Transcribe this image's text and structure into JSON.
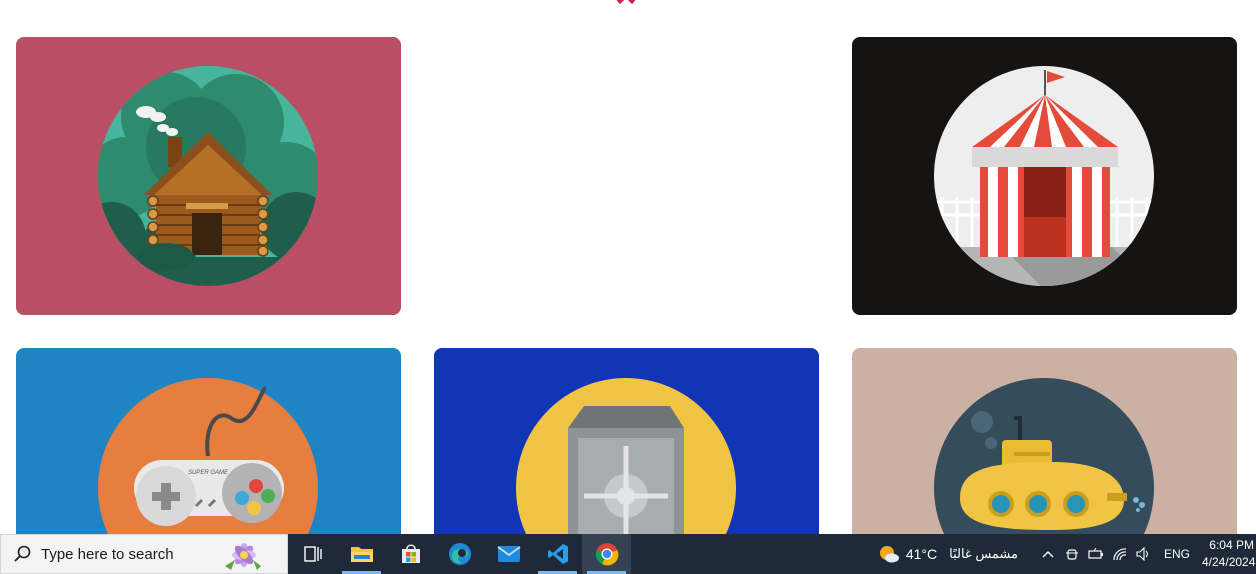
{
  "taskbar": {
    "search_placeholder": "Type here to search",
    "apps": [
      "task-view",
      "file-explorer",
      "microsoft-store",
      "edge",
      "mail",
      "vscode",
      "chrome"
    ]
  },
  "tray": {
    "temperature": "41°C",
    "weather_condition": "مشمس غالبًا",
    "language": "ENG",
    "time": "6:04 PM",
    "date": "4/24/2024"
  },
  "cards": [
    {
      "id": "cabin",
      "background": "#b94e65",
      "circle": "#47b49b",
      "icon": "log-cabin"
    },
    {
      "id": "circus",
      "background": "#161412",
      "circle": "#eeeeee",
      "icon": "circus-tent"
    },
    {
      "id": "controller",
      "background": "#1f84c4",
      "circle": "#e57e3f",
      "icon": "game-controller"
    },
    {
      "id": "safe",
      "background": "#1235b6",
      "circle": "#f0c544",
      "icon": "safe"
    },
    {
      "id": "sub",
      "background": "#cbb1a4",
      "circle": "#344c5c",
      "icon": "submarine"
    }
  ],
  "controller_label": "SUPER GAME"
}
